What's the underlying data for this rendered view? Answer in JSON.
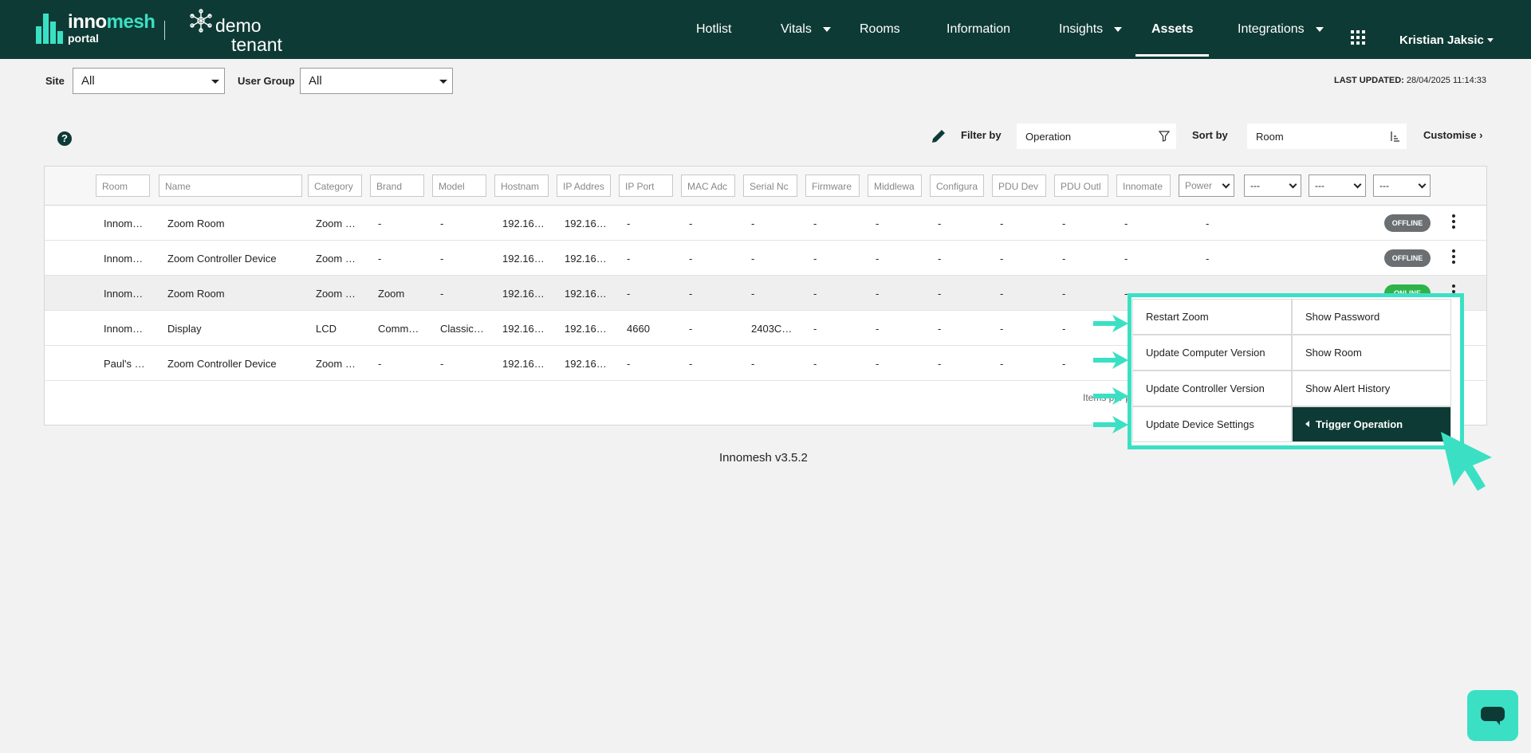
{
  "brand": {
    "name_part1": "inno",
    "name_part2": "mesh",
    "sub": "portal",
    "tenant_line1": "demo",
    "tenant_line2": "tenant"
  },
  "nav": {
    "items": [
      "Hotlist",
      "Vitals",
      "Rooms",
      "Information",
      "Insights",
      "Assets",
      "Integrations"
    ],
    "active": "Assets",
    "user": "Kristian Jaksic"
  },
  "filters": {
    "site_label": "Site",
    "site_value": "All",
    "user_group_label": "User Group",
    "user_group_value": "All",
    "last_updated_label": "LAST UPDATED:",
    "last_updated_value": "28/04/2025 11:14:33"
  },
  "toolbar": {
    "help": "?",
    "filter_label": "Filter by",
    "filter_value": "Operation",
    "sort_label": "Sort by",
    "sort_value": "Room",
    "customise": "Customise"
  },
  "columns": [
    "Room",
    "Name",
    "Category",
    "Brand",
    "Model",
    "Hostnam",
    "IP Addres",
    "IP Port",
    "MAC Adc",
    "Serial Nc",
    "Firmware",
    "Middlewa",
    "Configura",
    "PDU Dev",
    "PDU Outl",
    "Innomate",
    "Power"
  ],
  "column_selects": [
    "---",
    "---",
    "---"
  ],
  "rows": [
    {
      "cells": [
        "Innom…",
        "Zoom Room",
        "Zoom …",
        "-",
        "-",
        "192.16…",
        "192.16…",
        "-",
        "-",
        "-",
        "-",
        "-",
        "-",
        "-",
        "-",
        "-",
        "-"
      ],
      "status": "OFFLINE",
      "status_color": "#6b6f72"
    },
    {
      "cells": [
        "Innom…",
        "Zoom Controller Device",
        "Zoom …",
        "-",
        "-",
        "192.16…",
        "192.16…",
        "-",
        "-",
        "-",
        "-",
        "-",
        "-",
        "-",
        "-",
        "-",
        "-"
      ],
      "status": "OFFLINE",
      "status_color": "#6b6f72"
    },
    {
      "cells": [
        "Innom…",
        "Zoom Room",
        "Zoom …",
        "Zoom",
        "-",
        "192.16…",
        "192.16…",
        "-",
        "-",
        "-",
        "-",
        "-",
        "-",
        "-",
        "-",
        "-",
        "-"
      ],
      "status": "ONLINE",
      "status_color": "#2db34a"
    },
    {
      "cells": [
        "Innom…",
        "Display",
        "LCD",
        "Comm…",
        "Classic…",
        "192.16…",
        "192.16…",
        "4660",
        "-",
        "2403C…",
        "-",
        "-",
        "-",
        "-",
        "-",
        "",
        ""
      ],
      "status": "",
      "status_color": ""
    },
    {
      "cells": [
        "Paul's …",
        "Zoom Controller Device",
        "Zoom …",
        "-",
        "-",
        "192.16…",
        "192.16…",
        "-",
        "-",
        "-",
        "-",
        "-",
        "-",
        "-",
        "-",
        "",
        ""
      ],
      "status": "",
      "status_color": ""
    }
  ],
  "pagination": {
    "items_per_page_label": "Items per p"
  },
  "footer": {
    "version": "Innomesh v3.5.2"
  },
  "menu": {
    "left": [
      "Restart Zoom",
      "Update Computer Version",
      "Update Controller Version",
      "Update Device Settings"
    ],
    "right": [
      "Show Password",
      "Show Room",
      "Show Alert History",
      "Trigger Operation"
    ]
  },
  "colors": {
    "header": "#0e3a35",
    "accent": "#3be0c4"
  }
}
